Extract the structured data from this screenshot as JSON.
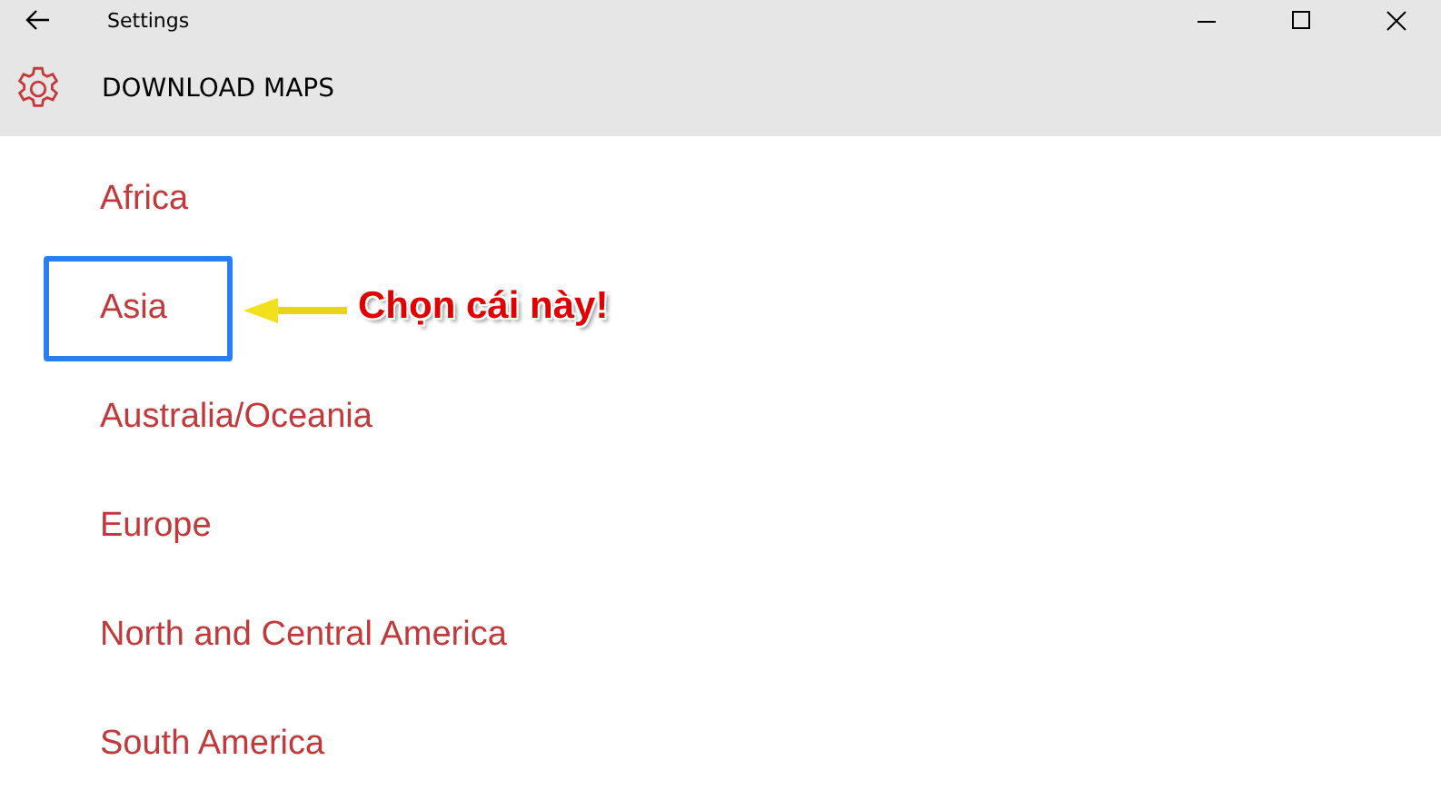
{
  "window": {
    "title": "Settings"
  },
  "header": {
    "title": "DOWNLOAD MAPS"
  },
  "regions": [
    {
      "label": "Africa",
      "highlighted": false
    },
    {
      "label": "Asia",
      "highlighted": true
    },
    {
      "label": "Australia/Oceania",
      "highlighted": false
    },
    {
      "label": "Europe",
      "highlighted": false
    },
    {
      "label": "North and Central America",
      "highlighted": false
    },
    {
      "label": "South America",
      "highlighted": false
    }
  ],
  "annotation": {
    "text": "Chọn cái này!"
  }
}
